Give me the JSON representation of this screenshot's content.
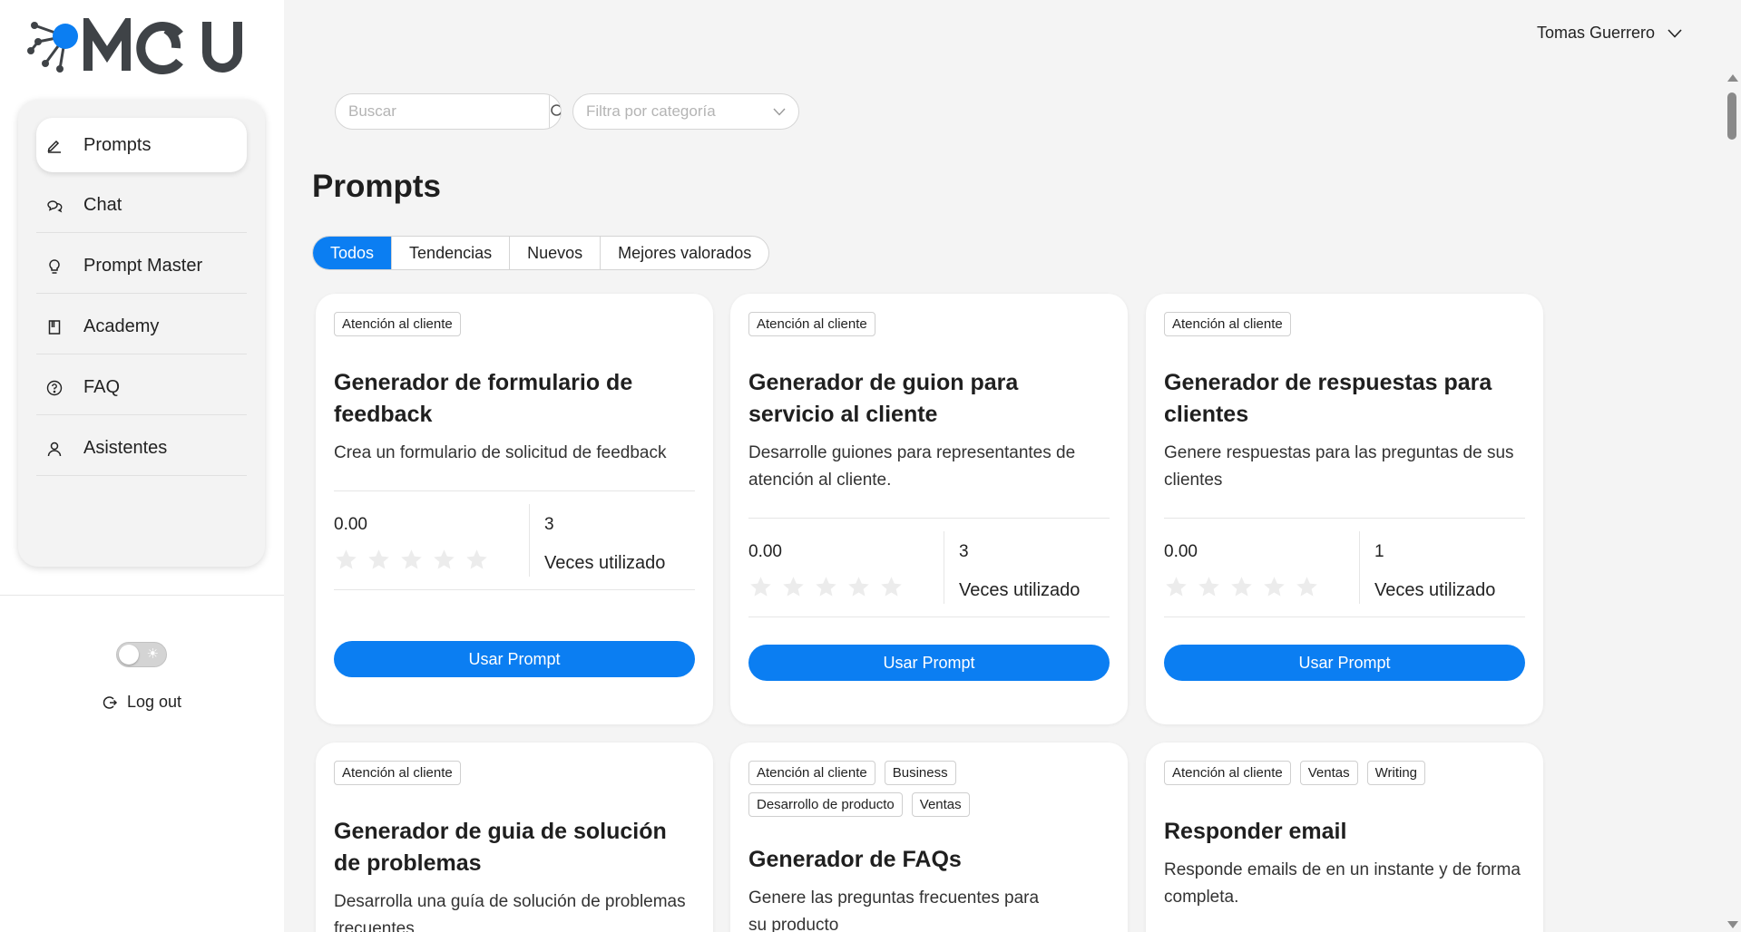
{
  "app": {
    "logo_text": "MOU",
    "brand_color": "#0b7ef2"
  },
  "sidebar": {
    "items": [
      {
        "label": "Prompts",
        "icon": "pencil-icon",
        "active": true
      },
      {
        "label": "Chat",
        "icon": "chat-bubbles-icon",
        "active": false
      },
      {
        "label": "Prompt Master",
        "icon": "lightbulb-icon",
        "active": false
      },
      {
        "label": "Academy",
        "icon": "book-icon",
        "active": false
      },
      {
        "label": "FAQ",
        "icon": "question-circle-icon",
        "active": false
      },
      {
        "label": "Asistentes",
        "icon": "user-icon",
        "active": false
      }
    ],
    "theme_toggle": {
      "icon": "sun-icon",
      "on": false
    },
    "logout_label": "Log out"
  },
  "header": {
    "user_name": "Tomas Guerrero"
  },
  "filters": {
    "search_placeholder": "Buscar",
    "category_placeholder": "Filtra por categoría"
  },
  "main": {
    "title": "Prompts",
    "tabs": [
      {
        "label": "Todos",
        "active": true
      },
      {
        "label": "Tendencias",
        "active": false
      },
      {
        "label": "Nuevos",
        "active": false
      },
      {
        "label": "Mejores valorados",
        "active": false
      }
    ],
    "use_button_label": "Usar Prompt",
    "uses_label": "Veces utilizado",
    "cards": [
      {
        "tags": [
          "Atención al cliente"
        ],
        "title": "Generador de formulario de feedback",
        "description": "Crea un formulario de solicitud de feedback",
        "rating": "0.00",
        "stars": 0,
        "uses": "3"
      },
      {
        "tags": [
          "Atención al cliente"
        ],
        "title": "Generador de guion para servicio al cliente",
        "description": "Desarrolle guiones para representantes de atención al cliente.",
        "rating": "0.00",
        "stars": 0,
        "uses": "3"
      },
      {
        "tags": [
          "Atención al cliente"
        ],
        "title": "Generador de respuestas para clientes",
        "description": "Genere respuestas para las preguntas de sus clientes",
        "rating": "0.00",
        "stars": 0,
        "uses": "1"
      },
      {
        "tags": [
          "Atención al cliente"
        ],
        "title": "Generador de guia de solución de problemas",
        "description": "Desarrolla una guía de solución de problemas frecuentes"
      },
      {
        "tags": [
          "Atención al cliente",
          "Business",
          "Desarrollo de producto",
          "Ventas"
        ],
        "title": "Generador de FAQs",
        "description": "Genere las preguntas frecuentes para su producto"
      },
      {
        "tags": [
          "Atención al cliente",
          "Ventas",
          "Writing"
        ],
        "title": "Responder email",
        "description": "Responde emails de en un instante y de forma completa."
      }
    ]
  }
}
